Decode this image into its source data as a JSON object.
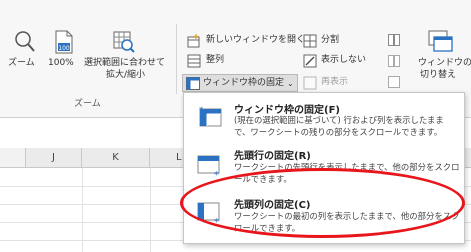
{
  "ribbon": {
    "zoom_group": {
      "zoom_label": "ズーム",
      "zoom100_label": "100%",
      "zoom_selection_line1": "選択範囲に合わせて",
      "zoom_selection_line2": "拡大/縮小",
      "group_label": "ズーム"
    },
    "window_group": {
      "new_window": "新しいウィンドウを開く",
      "arrange": "整列",
      "freeze_panes": "ウィンドウ枠の固定",
      "split": "分割",
      "hide": "表示しない",
      "unhide": "再表示",
      "switch_windows_line1": "ウィンドウの",
      "switch_windows_line2": "切り替え"
    }
  },
  "sheet": {
    "columns": [
      "J",
      "K",
      "L"
    ]
  },
  "freeze_menu": {
    "items": [
      {
        "title": "ウィンドウ枠の固定(F)",
        "desc": "(現在の選択範囲に基づいて) 行および列を表示したままで、ワークシートの残りの部分をスクロールできます。"
      },
      {
        "title": "先頭行の固定(R)",
        "desc": "ワークシートの先頭行を表示したままで、他の部分をスクロールできます。"
      },
      {
        "title": "先頭列の固定(C)",
        "desc": "ワークシートの最初の列を表示したままで、他の部分をスクロールできます。"
      }
    ]
  },
  "colors": {
    "accent_blue": "#2b72c2",
    "highlight_red": "#e8161b"
  }
}
